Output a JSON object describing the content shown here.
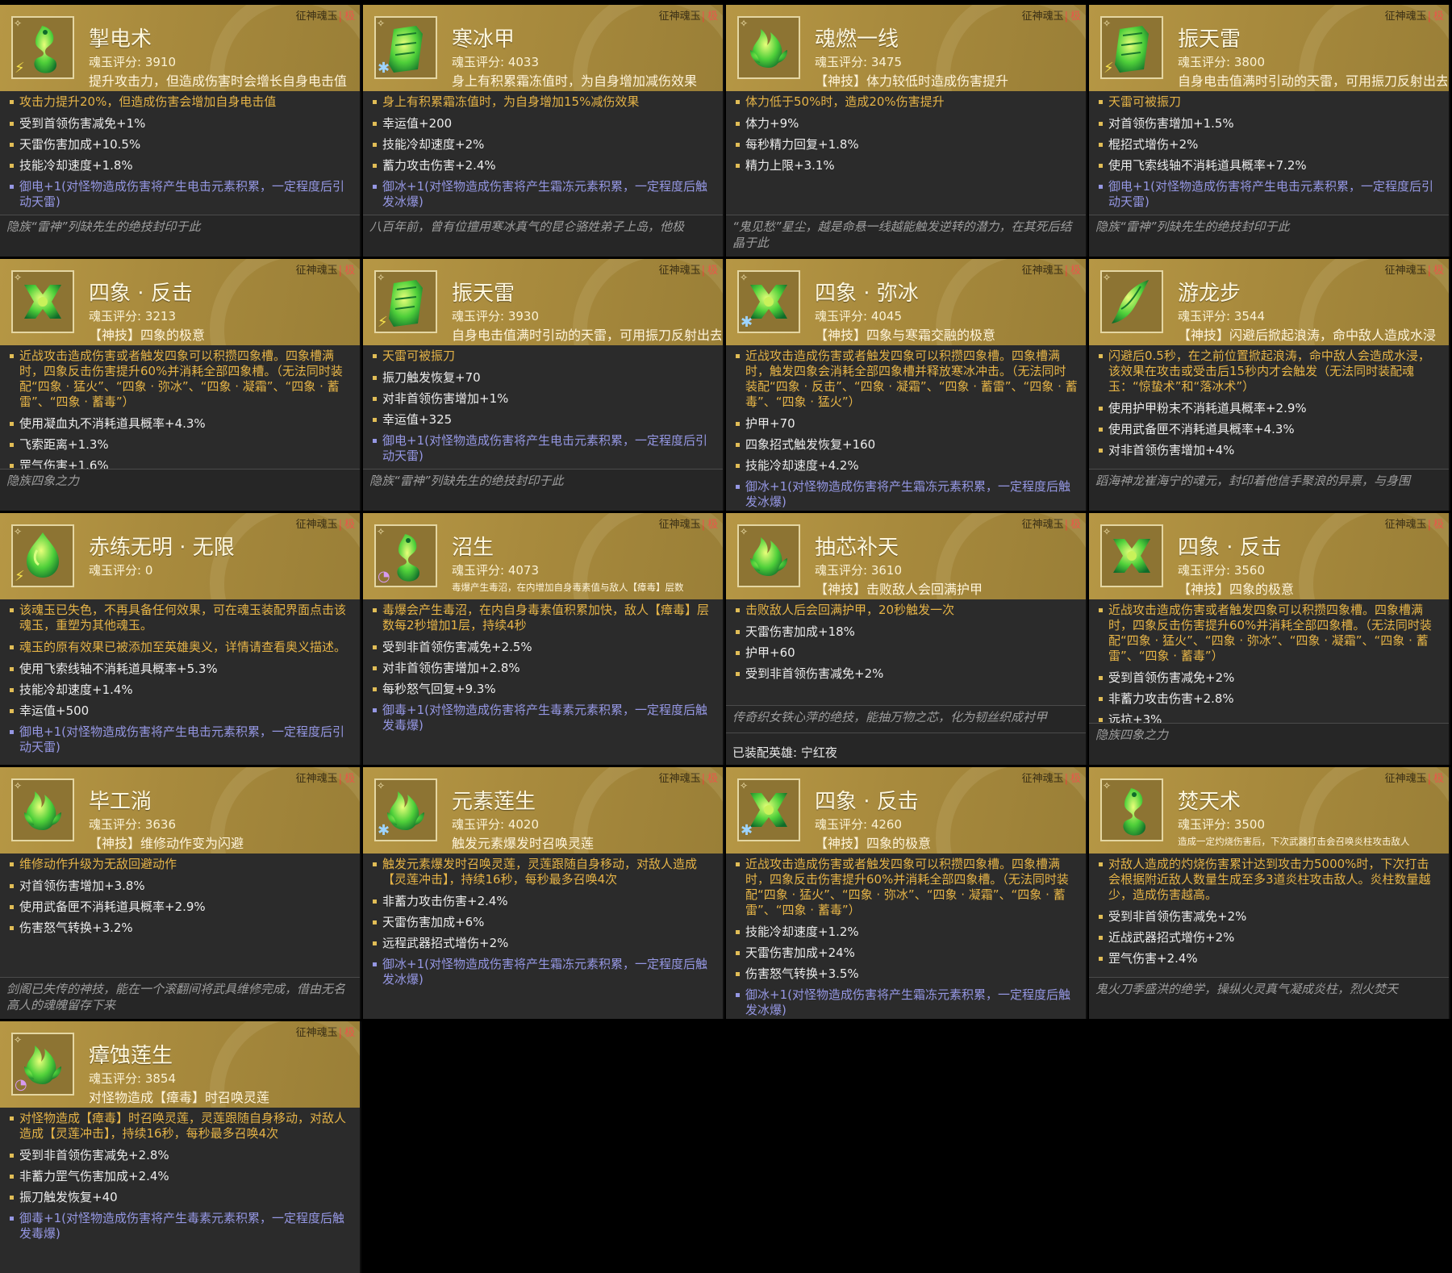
{
  "cards": [
    {
      "tag": "征神魂玉",
      "level": "极",
      "element": "⚡",
      "element_type": "thunder",
      "icon": "dragon-jade-icon",
      "icon_type": "dragon",
      "title": "掣电术",
      "score": "魂玉评分: 3910",
      "desc": "提升攻击力，但造成伤害时会增长自身电击值",
      "main_effects": [
        "攻击力提升20%，但造成伤害会增加自身电击值"
      ],
      "stats": [
        "受到首领伤害减免+1%",
        "天雷伤害加成+10.5%",
        "技能冷却速度+1.8%"
      ],
      "special": "御电+1(对怪物造成伤害将产生电击元素积累，一定程度后引动天雷)",
      "footer": "隐族“雷神”列缺先生的绝技封印于此"
    },
    {
      "tag": "征神魂玉",
      "level": "极",
      "element": "✱",
      "element_type": "ice",
      "icon": "armor-jade-icon",
      "icon_type": "armor",
      "title": "寒冰甲",
      "score": "魂玉评分: 4033",
      "desc": "身上有积累霜冻值时，为自身增加减伤效果",
      "main_effects": [
        "身上有积累霜冻值时，为自身增加15%减伤效果"
      ],
      "stats": [
        "幸运值+200",
        "技能冷却速度+2%",
        "蓄力攻击伤害+2.4%"
      ],
      "special": "御冰+1(对怪物造成伤害将产生霜冻元素积累，一定程度后触发冰爆)",
      "footer": "八百年前，曾有位擅用寒冰真气的昆仑骆姓弟子上岛，他极"
    },
    {
      "tag": "征神魂玉",
      "level": "极",
      "element": "",
      "element_type": "",
      "icon": "flame-jade-icon",
      "icon_type": "flame",
      "title": "魂燃一线",
      "score": "魂玉评分: 3475",
      "desc": "【神技】体力较低时造成伤害提升",
      "main_effects": [
        "体力低于50%时，造成20%伤害提升"
      ],
      "stats": [
        "体力+9%",
        "每秒精力回复+1.8%",
        "精力上限+3.1%"
      ],
      "special": "",
      "footer": "“鬼见愁”星尘，越是命悬一线越能触发逆转的潜力，在其死后结晶于此"
    },
    {
      "tag": "征神魂玉",
      "level": "极",
      "element": "⚡",
      "element_type": "thunder",
      "icon": "armor-jade-icon",
      "icon_type": "armor",
      "title": "振天雷",
      "score": "魂玉评分: 3800",
      "desc": "自身电击值满时引动的天雷，可用振刀反射出去",
      "main_effects": [
        "天雷可被振刀"
      ],
      "stats": [
        "对首领伤害增加+1.5%",
        "棍招式增伤+2%",
        "使用飞索线轴不消耗道具概率+7.2%"
      ],
      "special": "御电+1(对怪物造成伤害将产生电击元素积累，一定程度后引动天雷)",
      "footer": "隐族“雷神”列缺先生的绝技封印于此"
    },
    {
      "tag": "征神魂玉",
      "level": "极",
      "element": "",
      "element_type": "",
      "icon": "sigil-jade-icon",
      "icon_type": "sigil",
      "title": "四象 · 反击",
      "score": "魂玉评分: 3213",
      "desc": "【神技】四象的极意",
      "main_effects": [
        "近战攻击造成伤害或者触发四象可以积攒四象槽。四象槽满时，四象反击伤害提升60%并消耗全部四象槽。（无法同时装配“四象 · 猛火”、“四象 · 弥冰”、“四象 · 凝霜”、“四象 · 蓄雷”、“四象 · 蓄毒”）"
      ],
      "stats": [
        "使用凝血丸不消耗道具概率+4.3%",
        "飞索距离+1.3%",
        "罡气伤害+1.6%"
      ],
      "special": "",
      "footer": "隐族四象之力"
    },
    {
      "tag": "征神魂玉",
      "level": "极",
      "element": "⚡",
      "element_type": "thunder",
      "icon": "armor-jade-icon",
      "icon_type": "armor",
      "title": "振天雷",
      "score": "魂玉评分: 3930",
      "desc": "自身电击值满时引动的天雷，可用振刀反射出去",
      "main_effects": [
        "天雷可被振刀"
      ],
      "stats": [
        "振刀触发恢复+70",
        "对非首领伤害增加+1%",
        "幸运值+325"
      ],
      "special": "御电+1(对怪物造成伤害将产生电击元素积累，一定程度后引动天雷)",
      "footer": "隐族“雷神”列缺先生的绝技封印于此"
    },
    {
      "tag": "征神魂玉",
      "level": "极",
      "element": "✱",
      "element_type": "ice",
      "icon": "sigil-jade-icon",
      "icon_type": "sigil",
      "title": "四象 · 弥冰",
      "score": "魂玉评分: 4045",
      "desc": "【神技】四象与寒霜交融的极意",
      "main_effects": [
        "近战攻击造成伤害或者触发四象可以积攒四象槽。四象槽满时，触发四象会消耗全部四象槽并释放寒冰冲击。（无法同时装配“四象 · 反击”、“四象 · 凝霜”、“四象 · 蓄雷”、“四象 · 蓄毒”、“四象 · 猛火”）"
      ],
      "stats": [
        "护甲+70",
        "四象招式触发恢复+160",
        "技能冷却速度+4.2%"
      ],
      "special": "御冰+1(对怪物造成伤害将产生霜冻元素积累，一定程度后触发冰爆)",
      "footer": ""
    },
    {
      "tag": "征神魂玉",
      "level": "极",
      "element": "",
      "element_type": "",
      "icon": "wave-jade-icon",
      "icon_type": "wave",
      "title": "游龙步",
      "score": "魂玉评分: 3544",
      "desc": "【神技】闪避后掀起浪涛，命中敌人造成水浸",
      "main_effects": [
        "闪避后0.5秒，在之前位置掀起浪涛，命中敌人会造成水浸，该效果在攻击或受击后15秒内才会触发（无法同时装配魂玉：“惊蛰术”和“落冰术”）"
      ],
      "stats": [
        "使用护甲粉末不消耗道具概率+2.9%",
        "使用武备匣不消耗道具概率+4.3%",
        "对非首领伤害增加+4%"
      ],
      "special": "",
      "footer": "蹈海神龙崔海宁的魂元，封印着他信手聚浪的异禀，与身围"
    },
    {
      "tag": "征神魂玉",
      "level": "极",
      "element": "⚡",
      "element_type": "thunder",
      "icon": "drop-jade-icon",
      "icon_type": "drop",
      "title": "赤练无明 · 无限",
      "score": "魂玉评分: 0",
      "desc": "",
      "main_effects": [
        "该魂玉已失色，不再具备任何效果，可在魂玉装配界面点击该魂玉，重塑为其他魂玉。",
        "魂玉的原有效果已被添加至英雄奥义，详情请查看奥义描述。"
      ],
      "stats": [
        "使用飞索线轴不消耗道具概率+5.3%",
        "技能冷却速度+1.4%",
        "幸运值+500"
      ],
      "special": "御电+1(对怪物造成伤害将产生电击元素积累，一定程度后引动天雷)",
      "footer": ""
    },
    {
      "tag": "征神魂玉",
      "level": "极",
      "element": "◔",
      "element_type": "poison",
      "icon": "dragon-jade-icon",
      "icon_type": "dragon",
      "title": "沼生",
      "score": "魂玉评分: 4073",
      "desc": "毒爆产生毒沼，在内增加自身毒素值与敌人【瘴毒】层数",
      "desc_small": true,
      "main_effects": [
        "毒爆会产生毒沼，在内自身毒素值积累加快，敌人【瘴毒】层数每2秒增加1层，持续4秒"
      ],
      "stats": [
        "受到非首领伤害减免+2.5%",
        "对非首领伤害增加+2.8%",
        "每秒怒气回复+9.3%"
      ],
      "special": "御毒+1(对怪物造成伤害将产生毒素元素积累，一定程度后触发毒爆)",
      "footer": ""
    },
    {
      "tag": "征神魂玉",
      "level": "极",
      "element": "",
      "element_type": "",
      "icon": "flame-jade-icon",
      "icon_type": "flame",
      "title": "抽芯补天",
      "score": "魂玉评分: 3610",
      "desc": "【神技】击败敌人会回满护甲",
      "main_effects": [
        "击败敌人后会回满护甲，20秒触发一次"
      ],
      "stats": [
        "天雷伤害加成+18%",
        "护甲+60",
        "受到非首领伤害减免+2%"
      ],
      "special": "",
      "footer": "传奇织女铁心萍的绝技，能抽万物之芯，化为韧丝织成衬甲",
      "equipped": "已装配英雄: 宁红夜"
    },
    {
      "tag": "征神魂玉",
      "level": "极",
      "element": "",
      "element_type": "",
      "icon": "sigil-jade-icon",
      "icon_type": "sigil",
      "title": "四象 · 反击",
      "score": "魂玉评分: 3560",
      "desc": "【神技】四象的极意",
      "main_effects": [
        "近战攻击造成伤害或者触发四象可以积攒四象槽。四象槽满时，四象反击伤害提升60%并消耗全部四象槽。（无法同时装配“四象 · 猛火”、“四象 · 弥冰”、“四象 · 凝霜”、“四象 · 蓄雷”、“四象 · 蓄毒”）"
      ],
      "stats": [
        "受到首领伤害减免+2%",
        "非蓄力攻击伤害+2.8%",
        "远抗+3%"
      ],
      "special": "",
      "footer": "隐族四象之力"
    },
    {
      "tag": "征神魂玉",
      "level": "极",
      "element": "",
      "element_type": "",
      "icon": "flame-jade-icon",
      "icon_type": "flame",
      "title": "毕工淌",
      "score": "魂玉评分: 3636",
      "desc": "【神技】维修动作变为闪避",
      "main_effects": [
        "维修动作升级为无敌回避动作"
      ],
      "stats": [
        "对首领伤害增加+3.8%",
        "使用武备匣不消耗道具概率+2.9%",
        "伤害怒气转换+3.2%"
      ],
      "special": "",
      "footer": "剑阁已失传的神技，能在一个滚翻间将武具维修完成，借由无名高人的魂魄留存下来"
    },
    {
      "tag": "征神魂玉",
      "level": "极",
      "element": "✱",
      "element_type": "ice",
      "icon": "flame-jade-icon",
      "icon_type": "flame",
      "title": "元素莲生",
      "score": "魂玉评分: 4020",
      "desc": "触发元素爆发时召唤灵莲",
      "main_effects": [
        "触发元素爆发时召唤灵莲，灵莲跟随自身移动，对敌人造成【灵莲冲击】，持续16秒，每秒最多召唤4次"
      ],
      "stats": [
        "非蓄力攻击伤害+2.4%",
        "天雷伤害加成+6%",
        "远程武器招式增伤+2%"
      ],
      "special": "御冰+1(对怪物造成伤害将产生霜冻元素积累，一定程度后触发冰爆)",
      "footer": ""
    },
    {
      "tag": "征神魂玉",
      "level": "极",
      "element": "✱",
      "element_type": "ice",
      "icon": "sigil-jade-icon",
      "icon_type": "sigil",
      "title": "四象 · 反击",
      "score": "魂玉评分: 4260",
      "desc": "【神技】四象的极意",
      "main_effects": [
        "近战攻击造成伤害或者触发四象可以积攒四象槽。四象槽满时，四象反击伤害提升60%并消耗全部四象槽。（无法同时装配“四象 · 猛火”、“四象 · 弥冰”、“四象 · 凝霜”、“四象 · 蓄雷”、“四象 · 蓄毒”）"
      ],
      "stats": [
        "技能冷却速度+1.2%",
        "天雷伤害加成+24%",
        "伤害怒气转换+3.5%"
      ],
      "special": "御冰+1(对怪物造成伤害将产生霜冻元素积累，一定程度后触发冰爆)",
      "footer": ""
    },
    {
      "tag": "征神魂玉",
      "level": "极",
      "element": "",
      "element_type": "",
      "icon": "dragon-jade-icon",
      "icon_type": "dragon",
      "title": "焚天术",
      "score": "魂玉评分: 3500",
      "desc": "造成一定灼烧伤害后，下次武器打击会召唤炎柱攻击敌人",
      "desc_small": true,
      "main_effects": [
        "对敌人造成的灼烧伤害累计达到攻击力5000%时，下次打击会根据附近敌人数量生成至多3道炎柱攻击敌人。炎柱数量越少，造成伤害越高。"
      ],
      "stats": [
        "受到非首领伤害减免+2%",
        "近战武器招式增伤+2%",
        "罡气伤害+2.4%"
      ],
      "special": "",
      "footer": "鬼火刀季盛洪的绝学，操纵火灵真气凝成炎柱，烈火焚天"
    },
    {
      "tag": "征神魂玉",
      "level": "极",
      "element": "◔",
      "element_type": "poison",
      "icon": "flame-jade-icon",
      "icon_type": "flame",
      "title": "瘴蚀莲生",
      "score": "魂玉评分: 3854",
      "desc": "对怪物造成【瘴毒】时召唤灵莲",
      "main_effects": [
        "对怪物造成【瘴毒】时召唤灵莲，灵莲跟随自身移动，对敌人造成【灵莲冲击】，持续16秒，每秒最多召唤4次"
      ],
      "stats": [
        "受到非首领伤害减免+2.8%",
        "非蓄力罡气伤害加成+2.4%",
        "振刀触发恢复+40"
      ],
      "special": "御毒+1(对怪物造成伤害将产生毒素元素积累，一定程度后触发毒爆)",
      "footer": ""
    }
  ]
}
